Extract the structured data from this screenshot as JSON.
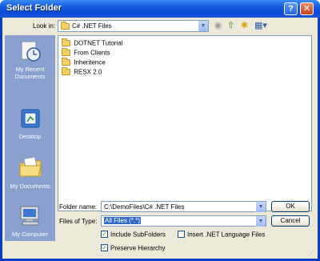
{
  "window": {
    "title": "Select Folder",
    "help_label": "?",
    "close_label": "✕"
  },
  "lookin": {
    "label": "Look in:",
    "value": "C# .NET Files"
  },
  "toolbar": {
    "icons": [
      "back-icon",
      "up-folder-icon",
      "new-folder-icon",
      "views-menu-icon"
    ]
  },
  "places": [
    {
      "label": "My Recent Documents",
      "icon": "recent-documents-icon"
    },
    {
      "label": "Desktop",
      "icon": "desktop-icon"
    },
    {
      "label": "My Documents",
      "icon": "my-documents-icon"
    },
    {
      "label": "My Computer",
      "icon": "my-computer-icon"
    }
  ],
  "files": [
    {
      "name": "DOTNET Tutorial"
    },
    {
      "name": "From Clients"
    },
    {
      "name": "Inheritence"
    },
    {
      "name": "RESX 2.0"
    }
  ],
  "folder_name": {
    "label": "Folder name:",
    "value": "C:\\DemoFiles\\C# .NET Files"
  },
  "files_of_type": {
    "label": "Files of Type:",
    "value": "All Files (*.*)"
  },
  "buttons": {
    "ok": "OK",
    "cancel": "Cancel"
  },
  "options": {
    "include_subfolders": {
      "label": "Include SubFolders",
      "checked": true
    },
    "insert_net_language_files": {
      "label": "Insert .NET Language Files",
      "checked": false
    },
    "preserve_hierarchy": {
      "label": "Preserve Hierarchy",
      "checked": true
    }
  },
  "colors": {
    "title_bar": "#0b4ad6",
    "places_bar": "#8aa1d0",
    "dialog_face": "#ece9d8",
    "selection": "#316ac5",
    "check_mark": "#21a121"
  }
}
